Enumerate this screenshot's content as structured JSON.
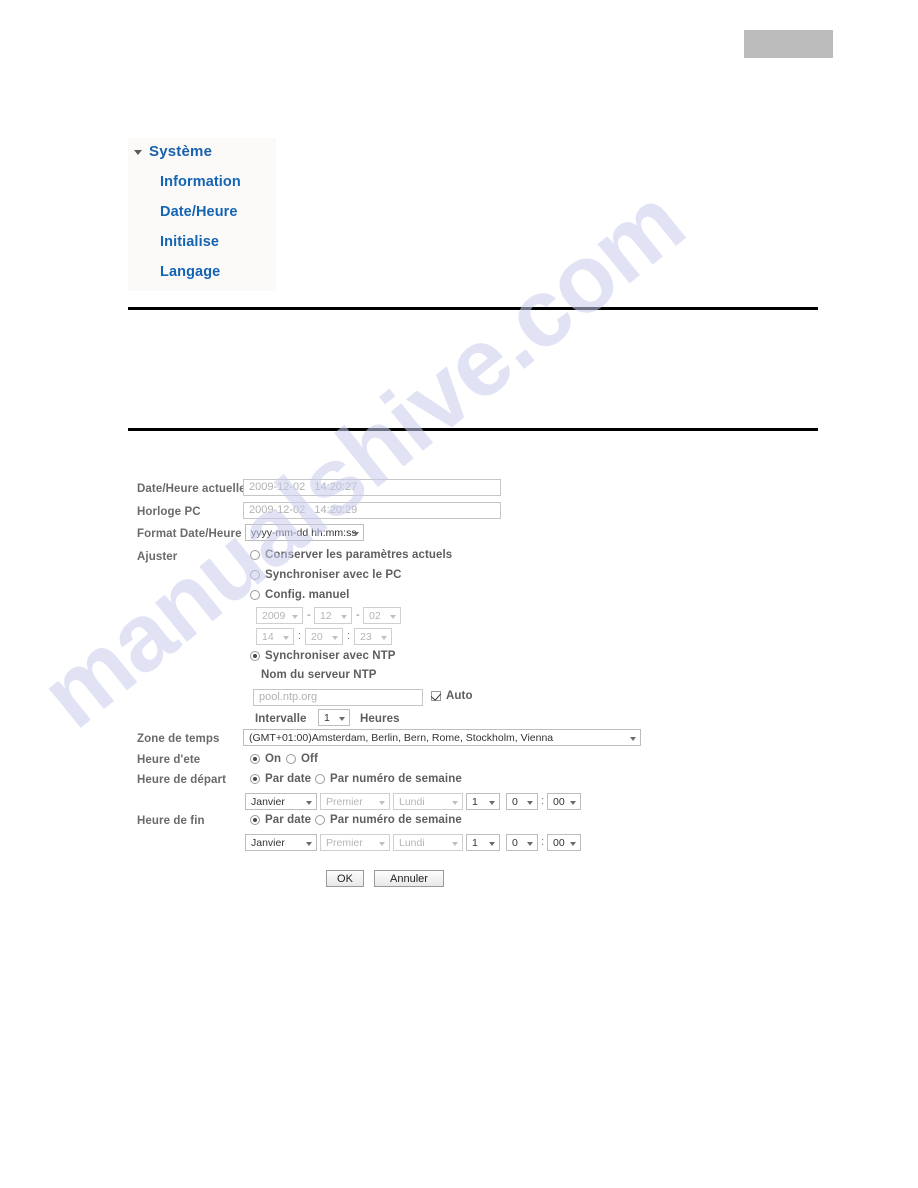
{
  "watermark": {
    "text": "manualshive.com"
  },
  "header": {
    "redacted_block": ""
  },
  "sidebar": {
    "root": {
      "label": "Système",
      "icon": "caret-down-icon"
    },
    "items": [
      {
        "label": "Information"
      },
      {
        "label": "Date/Heure"
      },
      {
        "label": "Initialise"
      },
      {
        "label": "Langage"
      }
    ]
  },
  "form": {
    "current_datetime": {
      "label": "Date/Heure actuelle",
      "value": "2009-12-02   14:20:27"
    },
    "pc_clock": {
      "label": "Horloge PC",
      "value": "2009-12-02   14:20:29"
    },
    "datetime_format": {
      "label": "Format Date/Heure",
      "value": "yyyy-mm-dd hh:mm:ss"
    },
    "adjust": {
      "label": "Ajuster",
      "options": [
        {
          "label": "Conserver les paramètres actuels",
          "selected": false
        },
        {
          "label": "Synchroniser avec le PC",
          "selected": false
        },
        {
          "label": "Config. manuel",
          "selected": false
        },
        {
          "label": "Synchroniser avec NTP",
          "selected": true
        }
      ]
    },
    "manual": {
      "year": "2009",
      "month": "12",
      "day": "02",
      "hour": "14",
      "minute": "20",
      "second": "23",
      "date_sep": "-",
      "time_sep": ":"
    },
    "ntp": {
      "server_label": "Nom du serveur NTP",
      "server_value": "pool.ntp.org",
      "auto_label": "Auto",
      "auto_checked": true,
      "interval_label": "Intervalle",
      "interval_value": "1",
      "interval_unit": "Heures"
    },
    "timezone": {
      "label": "Zone de temps",
      "value": "(GMT+01:00)Amsterdam, Berlin, Bern, Rome, Stockholm, Vienna"
    },
    "dst": {
      "label": "Heure d'ete",
      "on_label": "On",
      "off_label": "Off",
      "on_selected": true
    },
    "start_time": {
      "label": "Heure de départ",
      "by_date_label": "Par date",
      "by_week_label": "Par numéro de semaine",
      "by_date_selected": true,
      "month": "Janvier",
      "ordinal": "Premier",
      "weekday": "Lundi",
      "day": "1",
      "hour": "0",
      "minute": "00",
      "time_sep": ":"
    },
    "end_time": {
      "label": "Heure de fin",
      "by_date_label": "Par date",
      "by_week_label": "Par numéro de semaine",
      "by_date_selected": true,
      "month": "Janvier",
      "ordinal": "Premier",
      "weekday": "Lundi",
      "day": "1",
      "hour": "0",
      "minute": "00",
      "time_sep": ":"
    },
    "buttons": {
      "ok": "OK",
      "cancel": "Annuler"
    }
  }
}
